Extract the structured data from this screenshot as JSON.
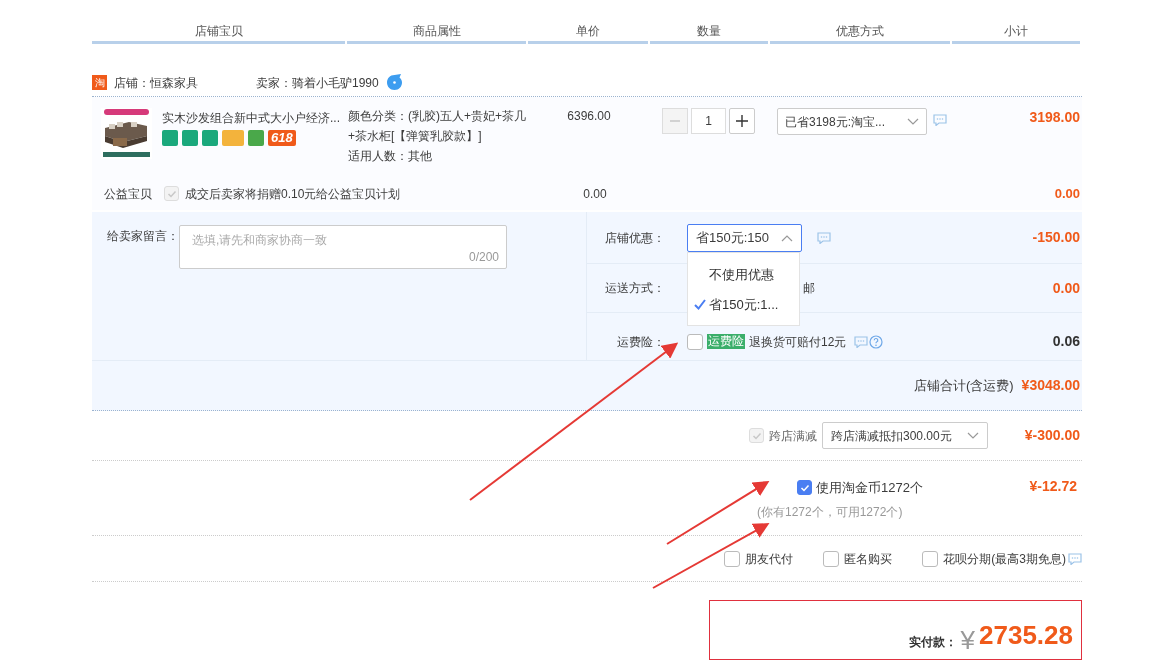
{
  "columns": [
    "店铺宝贝",
    "商品属性",
    "单价",
    "数量",
    "优惠方式",
    "小计"
  ],
  "shop": {
    "logo": "淘",
    "name": "店铺：恒森家具",
    "seller": "卖家：骑着小毛驴1990"
  },
  "item": {
    "title": "实木沙发组合新中式大小户经济...",
    "promo_badge": "618",
    "attributes": [
      "颜色分类：(乳胶)五人+贵妃+茶几+茶水柜[【弹簧乳胶款】]",
      "适用人数：其他"
    ],
    "price": "6396.00",
    "quantity": "1",
    "minus_disabled": true,
    "discount": "已省3198元:淘宝...",
    "subtotal": "3198.00"
  },
  "charity": {
    "label": "公益宝贝",
    "checked": true,
    "text": "成交后卖家将捐赠0.10元给公益宝贝计划",
    "price": "0.00",
    "subtotal": "0.00"
  },
  "message": {
    "label": "给卖家留言：",
    "placeholder": "选填,请先和商家协商一致",
    "counter": "0/200"
  },
  "shop_discount": {
    "label": "店铺优惠：",
    "value": "省150元:150",
    "expanded": true,
    "options": [
      {
        "label": "不使用优惠",
        "selected": false
      },
      {
        "label": "省150元:1...",
        "selected": true
      }
    ],
    "amount": "-150.00"
  },
  "shipping": {
    "label": "运送方式：",
    "value": "邮",
    "amount": "0.00"
  },
  "insurance": {
    "label": "运费险：",
    "checked": false,
    "tag": "运费险",
    "text": "退换货可赔付12元",
    "amount": "0.06"
  },
  "shop_total": {
    "label": "店铺合计(含运费)",
    "amount": "¥3048.00"
  },
  "cross_store": {
    "checked": true,
    "disabled": true,
    "label": "跨店满减",
    "select": "跨店满减抵扣300.00元",
    "amount": "¥-300.00"
  },
  "coins": {
    "checked": true,
    "label": "使用淘金币1272个",
    "note": "(你有1272个，可用1272个)",
    "amount": "¥-12.72"
  },
  "options": [
    {
      "label": "朋友代付",
      "checked": false
    },
    {
      "label": "匿名购买",
      "checked": false
    },
    {
      "label": "花呗分期(最高3期免息)",
      "checked": false
    }
  ],
  "payment": {
    "label": "实付款：",
    "currency": "¥",
    "amount": "2735.28"
  }
}
